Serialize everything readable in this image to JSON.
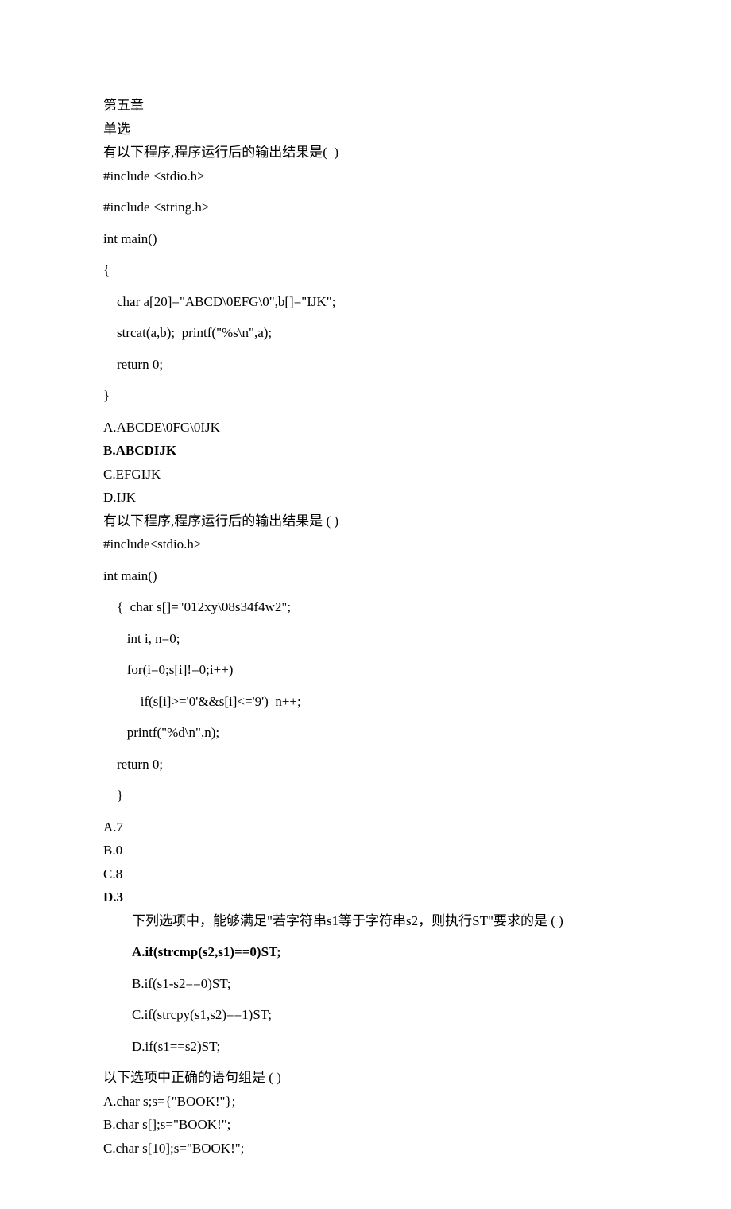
{
  "chapter_title": "第五章",
  "section_label": "单选",
  "q1": {
    "prompt": "有以下程序,程序运行后的输出结果是(  )",
    "code": [
      "#include <stdio.h>",
      "#include <string.h>",
      "int main()",
      "{",
      "    char a[20]=\"ABCD\\0EFG\\0\",b[]=\"IJK\";",
      "    strcat(a,b);  printf(\"%s\\n\",a);",
      "    return 0;",
      "}"
    ],
    "options": {
      "A": "A.ABCDE\\0FG\\0IJK",
      "B": "B.ABCDIJK",
      "C": "C.EFGIJK",
      "D": "D.IJK"
    }
  },
  "q2": {
    "prompt": "有以下程序,程序运行后的输出结果是 ( )",
    "code": [
      "#include<stdio.h>",
      "int main()",
      "    {  char s[]=\"012xy\\08s34f4w2\";",
      "       int i, n=0;",
      "       for(i=0;s[i]!=0;i++)",
      "           if(s[i]>='0'&&s[i]<='9')  n++;",
      "       printf(\"%d\\n\",n);",
      "    return 0;",
      "    }"
    ],
    "options": {
      "A": "A.7",
      "B": "B.0",
      "C": "C.8",
      "D": "D.3"
    }
  },
  "q3": {
    "prompt": "下列选项中，能够满足\"若字符串s1等于字符串s2，则执行ST\"要求的是 ( )",
    "options": {
      "A": "A.if(strcmp(s2,s1)==0)ST;",
      "B": "B.if(s1-s2==0)ST;",
      "C": "C.if(strcpy(s1,s2)==1)ST;",
      "D": "D.if(s1==s2)ST;"
    }
  },
  "q4": {
    "prompt": "以下选项中正确的语句组是 ( )",
    "options": {
      "A": "A.char s;s={\"BOOK!\"};",
      "B": "B.char s[];s=\"BOOK!\";",
      "C": "C.char s[10];s=\"BOOK!\";"
    }
  }
}
